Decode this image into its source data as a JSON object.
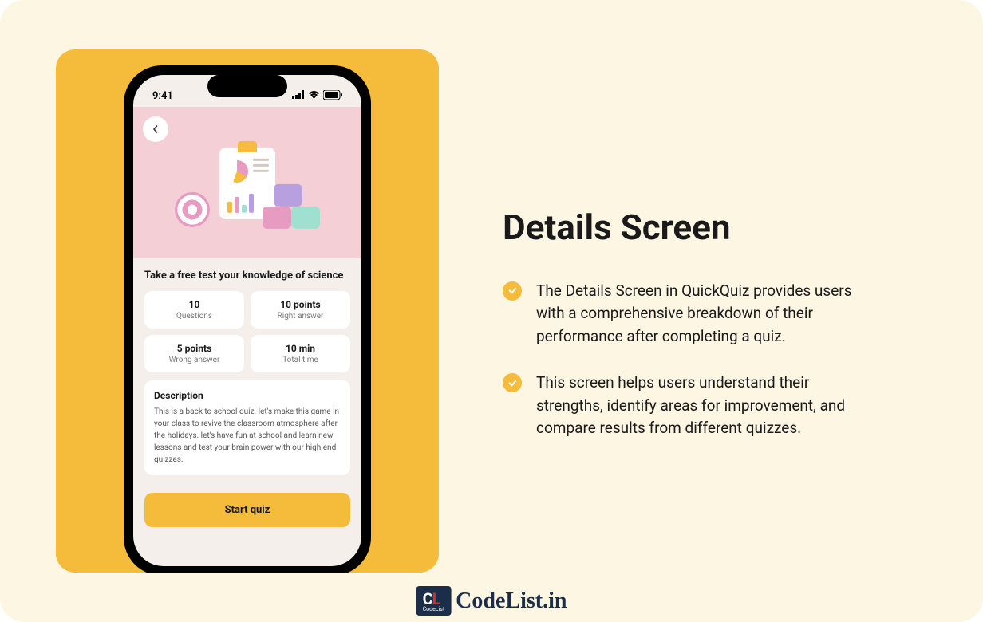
{
  "heading": "Details Screen",
  "bullets": [
    "The Details Screen in QuickQuiz provides users with a comprehensive breakdown of their performance after completing a quiz.",
    "This screen helps users understand their strengths, identify areas for improvement, and compare results from different quizzes."
  ],
  "phone": {
    "time": "9:41",
    "title": "Take a free test your knowledge of science",
    "stats": [
      {
        "value": "10",
        "label": "Questions"
      },
      {
        "value": "10 points",
        "label": "Right answer"
      },
      {
        "value": "5 points",
        "label": "Wrong answer"
      },
      {
        "value": "10 min",
        "label": "Total time"
      }
    ],
    "description_heading": "Description",
    "description_text": "This is a back to school quiz. let's make this game in your class to revive the classroom atmosphere after the holidays. let's have fun at school and learn new lessons and test your brain power with our high end quizzes.",
    "start_button": "Start quiz"
  },
  "watermark": {
    "badge_cl": "CL",
    "badge_sub": "CodeList",
    "text": "CodeList.in"
  }
}
